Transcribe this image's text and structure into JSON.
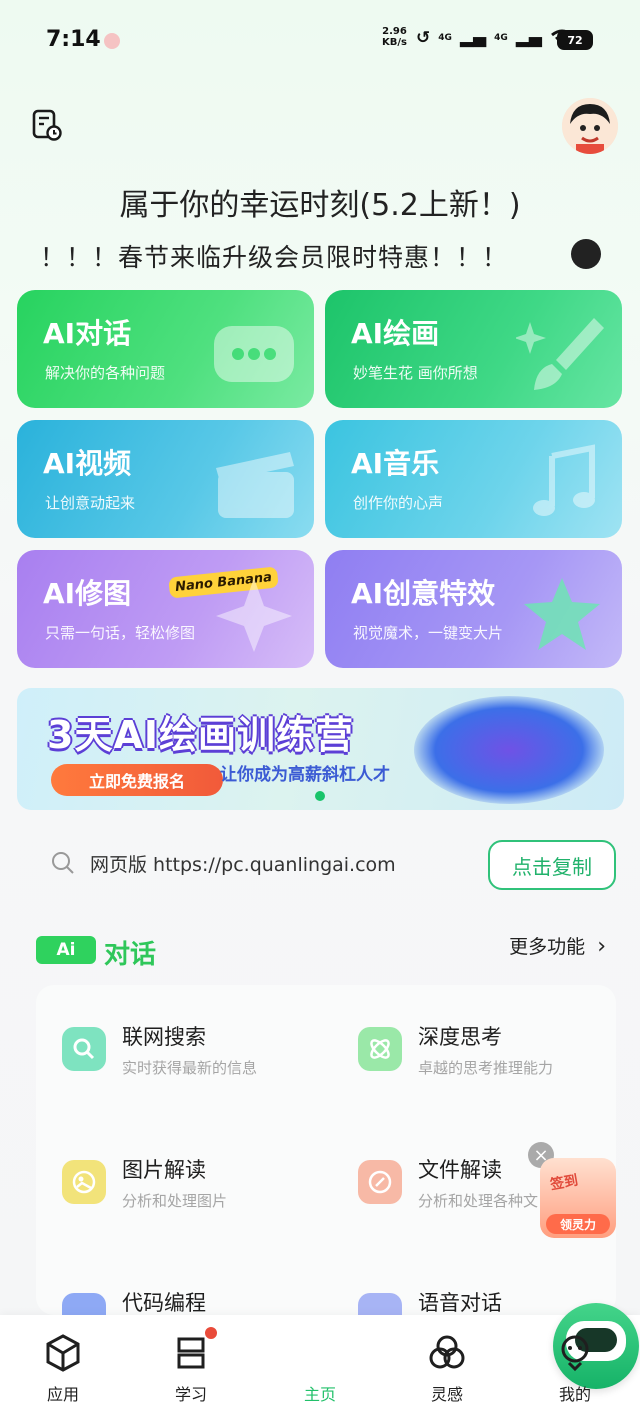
{
  "status_bar": {
    "time": "7:14",
    "speed_value": "2.96",
    "speed_unit": "KB/s",
    "network_1": "4G",
    "network_2": "4G",
    "battery": "72"
  },
  "headline": "属于你的幸运时刻(5.2上新！)",
  "ticker": "！！！春节来临升级会员限时特惠！！！",
  "features": [
    {
      "title": "AI对话",
      "subtitle": "解决你的各种问题"
    },
    {
      "title": "AI绘画",
      "subtitle": "妙笔生花 画你所想"
    },
    {
      "title": "AI视频",
      "subtitle": "让创意动起来"
    },
    {
      "title": "AI音乐",
      "subtitle": "创作你的心声"
    },
    {
      "title": "AI修图",
      "subtitle": "只需一句话，轻松修图",
      "badge": "Nano Banana"
    },
    {
      "title": "AI创意特效",
      "subtitle": "视觉魔术，一键变大片"
    }
  ],
  "banner": {
    "title": "3天AI绘画训练营",
    "button": "立即免费报名",
    "subtitle": "让你成为高薪斜杠人才"
  },
  "web_url": {
    "label": "网页版 https://pc.quanlingai.com",
    "copy_button": "点击复制"
  },
  "section": {
    "badge": "Ai",
    "title": "对话",
    "more": "更多功能"
  },
  "functions": [
    {
      "title": "联网搜索",
      "desc": "实时获得最新的信息"
    },
    {
      "title": "深度思考",
      "desc": "卓越的思考推理能力"
    },
    {
      "title": "图片解读",
      "desc": "分析和处理图片"
    },
    {
      "title": "文件解读",
      "desc": "分析和处理各种文"
    },
    {
      "title": "代码编程",
      "desc": ""
    },
    {
      "title": "语音对话",
      "desc": ""
    }
  ],
  "checkin": {
    "top": "签到",
    "bottom": "领灵力",
    "close": "×"
  },
  "tabs": [
    {
      "label": "应用"
    },
    {
      "label": "学习"
    },
    {
      "label": "主页"
    },
    {
      "label": "灵感"
    },
    {
      "label": "我的"
    }
  ],
  "colors": {
    "accent_green": "#22c06a",
    "badge_red": "#e94b3a"
  }
}
